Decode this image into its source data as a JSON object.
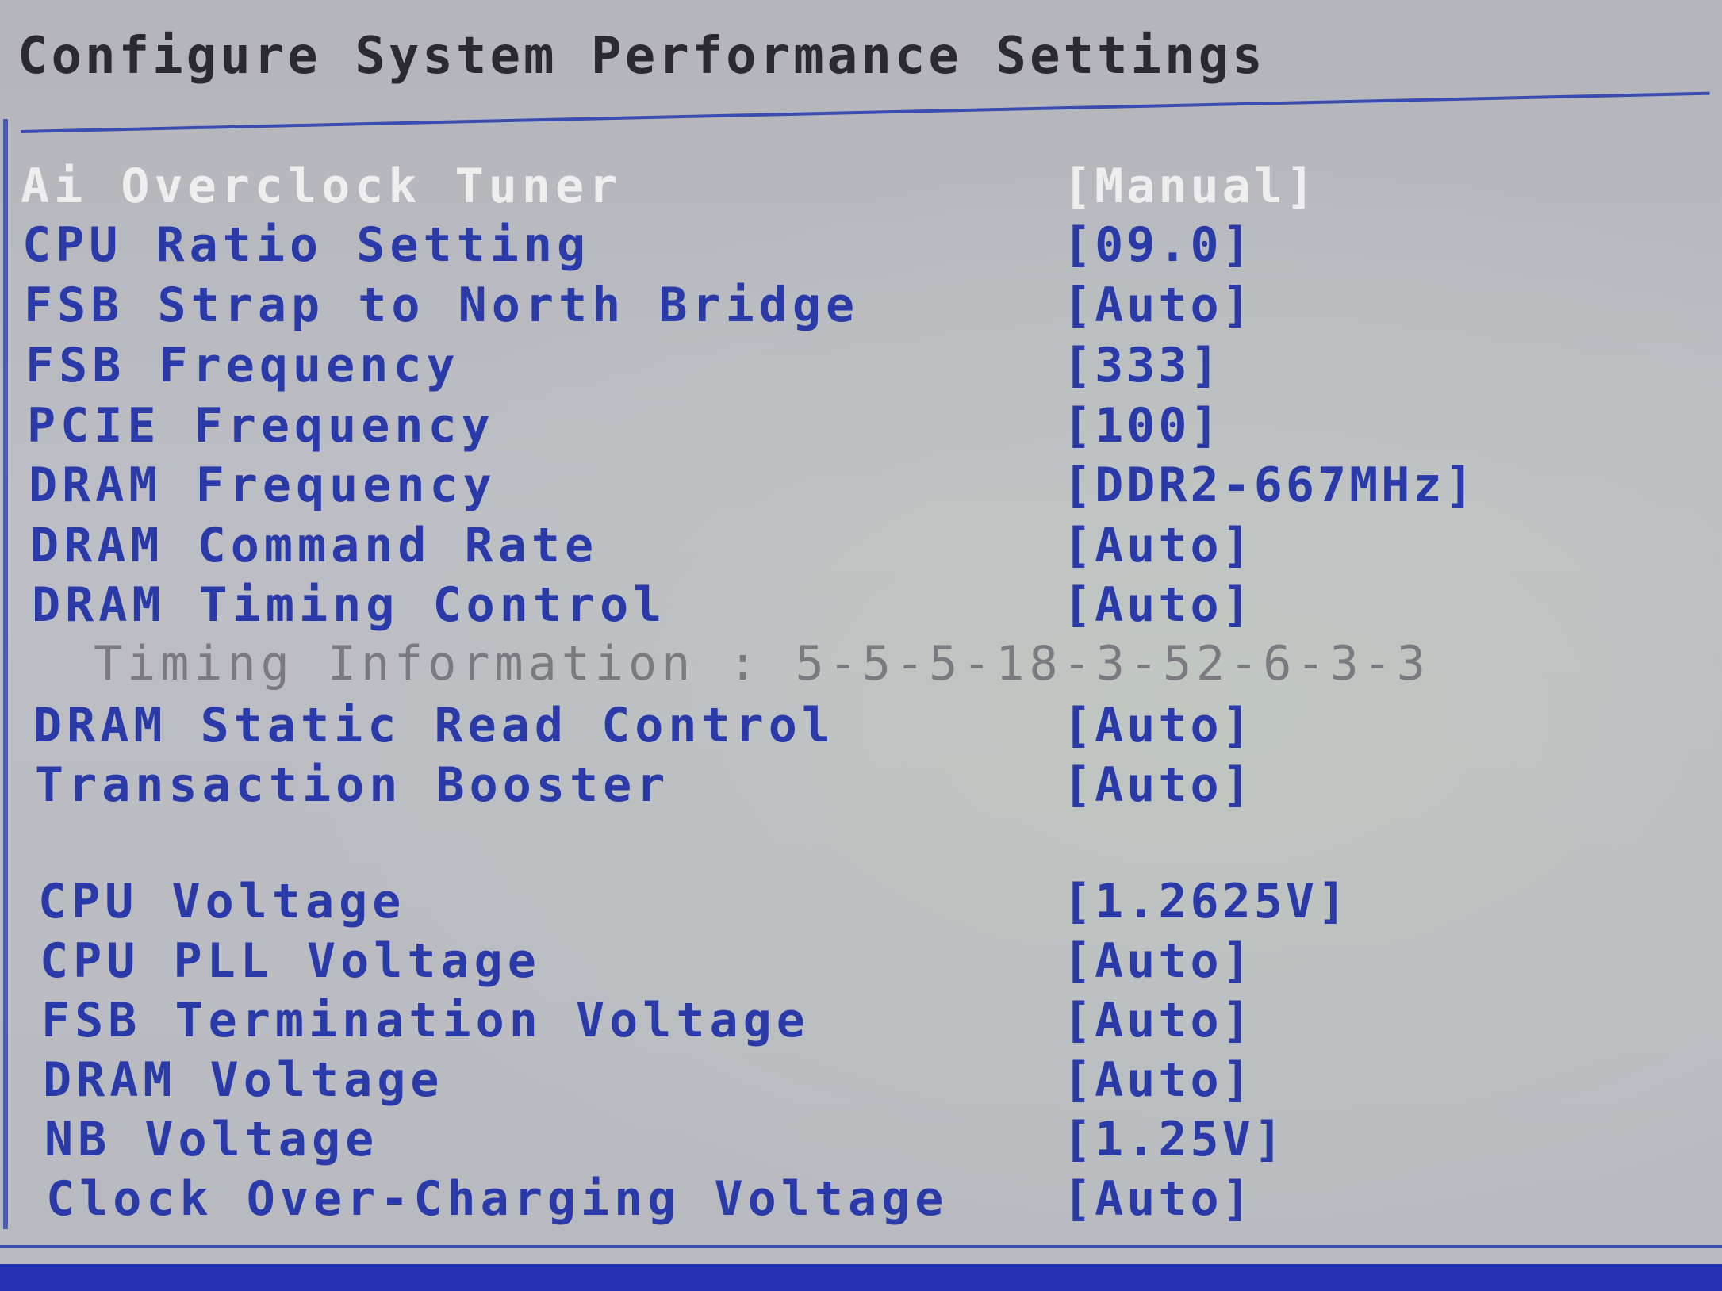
{
  "title": "Configure System Performance Settings",
  "settings": [
    {
      "label": "Ai Overclock Tuner",
      "value": "[Manual]"
    },
    {
      "label": "CPU Ratio Setting",
      "value": "[09.0]"
    },
    {
      "label": "FSB Strap to North Bridge",
      "value": "[Auto]"
    },
    {
      "label": "FSB Frequency",
      "value": "[333]"
    },
    {
      "label": "PCIE Frequency",
      "value": "[100]"
    },
    {
      "label": "DRAM Frequency",
      "value": "[DDR2-667MHz]"
    },
    {
      "label": "DRAM Command Rate",
      "value": "[Auto]"
    },
    {
      "label": "DRAM Timing Control",
      "value": "[Auto]"
    }
  ],
  "timing_info": "Timing Information : 5-5-5-18-3-52-6-3-3",
  "settings2": [
    {
      "label": "DRAM Static Read Control",
      "value": "[Auto]"
    },
    {
      "label": "Transaction Booster",
      "value": "[Auto]"
    }
  ],
  "voltages": [
    {
      "label": "CPU Voltage",
      "value": "[1.2625V]"
    },
    {
      "label": "CPU PLL Voltage",
      "value": "[Auto]"
    },
    {
      "label": "FSB Termination Voltage",
      "value": "[Auto]"
    },
    {
      "label": "DRAM Voltage",
      "value": "[Auto]"
    },
    {
      "label": "NB Voltage",
      "value": "[1.25V]"
    },
    {
      "label": "Clock Over-Charging Voltage",
      "value": "[Auto]"
    }
  ],
  "colors": {
    "background": "#b9bbc2",
    "option_text": "#2a3aa8",
    "selected_text": "#eeeeee",
    "info_text": "#7a7a80",
    "accent": "#2232b0"
  }
}
